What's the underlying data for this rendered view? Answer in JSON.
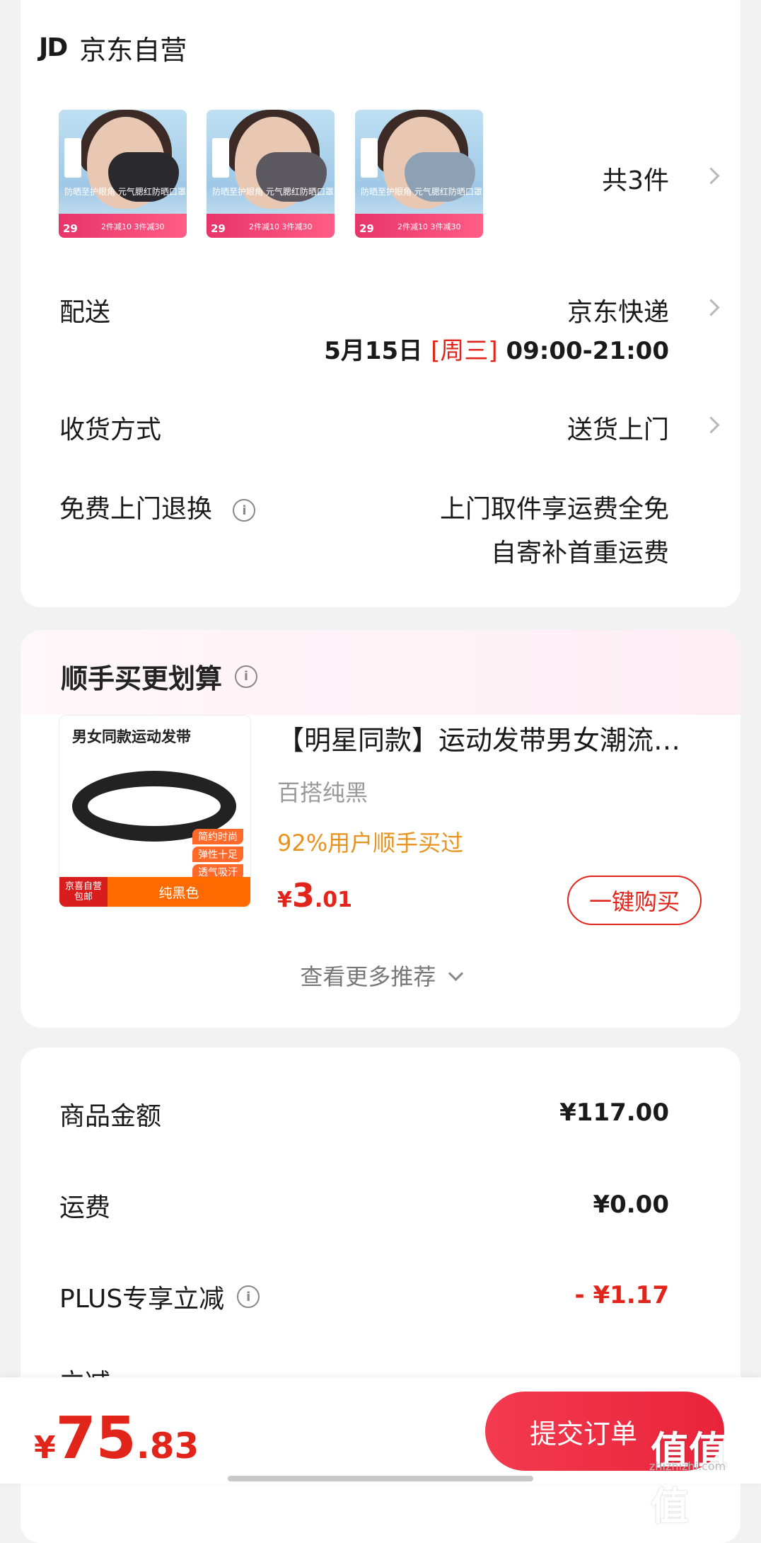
{
  "shop": {
    "logo": "JD",
    "name": "京东自营"
  },
  "order_items": {
    "count_text": "共3件",
    "thumbs": [
      {
        "caption": "防晒至护眼角 元气腮红防晒口罩",
        "price": "29",
        "promo": "2件减10 3件减30",
        "mask_color": "#2a2a2e"
      },
      {
        "caption": "防晒至护眼角 元气腮红防晒口罩",
        "price": "29",
        "promo": "2件减10 3件减30",
        "mask_color": "#5c5860"
      },
      {
        "caption": "防晒至护眼角 元气腮红防晒口罩",
        "price": "29",
        "promo": "2件减10 3件减30",
        "mask_color": "#8da1b4"
      }
    ]
  },
  "delivery": {
    "label": "配送",
    "carrier": "京东快递",
    "date": "5月15日",
    "weekday": "[周三]",
    "time": "09:00-21:00"
  },
  "receive_method": {
    "label": "收货方式",
    "value": "送货上门"
  },
  "free_return": {
    "label": "免费上门退换",
    "line1": "上门取件享运费全免",
    "line2": "自寄补首重运费"
  },
  "recommend": {
    "title": "顺手买更划算",
    "image_title": "男女同款运动发带",
    "image_tags": [
      "简约时尚",
      "弹性十足",
      "透气吸汗"
    ],
    "image_badge": "京喜自营 包邮",
    "image_color": "纯黑色",
    "name": "【明星同款】运动发带男女潮流健身跑步止汗带",
    "spec": "百搭纯黑",
    "social": "92%用户顺手买过",
    "price_cur": "¥",
    "price_int": "3",
    "price_dec": ".01",
    "buy_label": "一键购买",
    "more_label": "查看更多推荐"
  },
  "amounts": {
    "goods_label": "商品金额",
    "goods_value": "¥117.00",
    "shipping_label": "运费",
    "shipping_value": "¥0.00",
    "plus_label": "PLUS专享立减",
    "plus_value": "- ¥1.17",
    "partial_label": "立减"
  },
  "checkout": {
    "total_cur": "¥",
    "total_int": "75",
    "total_dec": ".83",
    "submit_label": "提交订单"
  },
  "watermark": {
    "text": "值值值",
    "sub": "zhizhizhi.com"
  },
  "colors": {
    "accent_red": "#e1251b",
    "social_orange": "#e8931f"
  }
}
